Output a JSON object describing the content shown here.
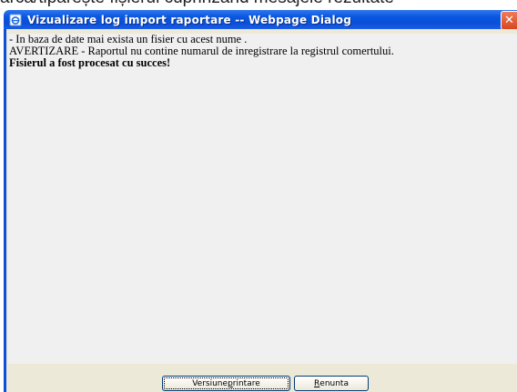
{
  "background_caption": "arca/tipărește fișierul cuprinzând mesajele rezultate",
  "window": {
    "title": "Vizualizare log import raportare -- Webpage Dialog",
    "close_glyph": "✕"
  },
  "log": {
    "line1": "- In baza de date mai exista un fisier cu acest nume .",
    "line2": "AVERTIZARE - Raportul nu contine numarul de inregistrare la registrul comertului.",
    "line3": "Fisierul a fost procesat cu succes!"
  },
  "buttons": {
    "print_prefix": "Versiune ",
    "print_accel": "p",
    "print_suffix": "rintare",
    "cancel_accel": "R",
    "cancel_suffix": "enunta"
  },
  "colors": {
    "titlebar": "#0a4fd6",
    "close_button": "#d8471f",
    "content_background": "#f0f0f0",
    "client_background": "#ece9d8"
  },
  "icons": [
    "ie-page-icon",
    "close-icon"
  ]
}
